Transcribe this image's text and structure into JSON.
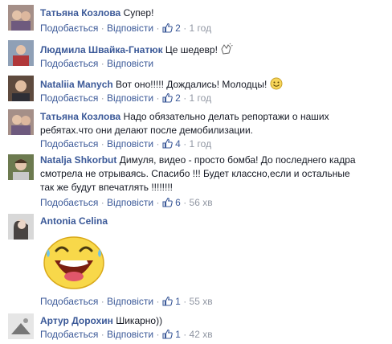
{
  "labels": {
    "like": "Подобається",
    "reply": "Відповісти",
    "dot": "·"
  },
  "comments": [
    {
      "author": "Татьяна Козлова",
      "text": "Супер!",
      "likes": "2",
      "time": "1 год"
    },
    {
      "author": "Людмила Швайка-Гнатюк",
      "text": "Це шедевр!",
      "likes": "",
      "time": ""
    },
    {
      "author": "Nataliia Manych",
      "text": "Вот оно!!!!! Дождались! Молодцы!",
      "likes": "2",
      "time": "1 год"
    },
    {
      "author": "Татьяна Козлова",
      "text": "Надо обязательно делать репортажи о наших ребятах.что они делают после демобилизации.",
      "likes": "4",
      "time": "1 год"
    },
    {
      "author": "Natalja Shkorbut",
      "text": "Димуля, видео - просто бомба! До последнего кадра смотрела не отрываясь. Спасибо !!! Будет классно,если и остальные так же будут впечатлять !!!!!!!!",
      "likes": "6",
      "time": "56 хв"
    },
    {
      "author": "Antonia Celina",
      "text": "",
      "likes": "1",
      "time": "55 хв"
    },
    {
      "author": "Артур Дорохин",
      "text": "Шикарно))",
      "likes": "1",
      "time": "42 хв"
    }
  ],
  "colors": {
    "link": "#3b5998",
    "meta": "#9197a3",
    "text": "#141823"
  }
}
